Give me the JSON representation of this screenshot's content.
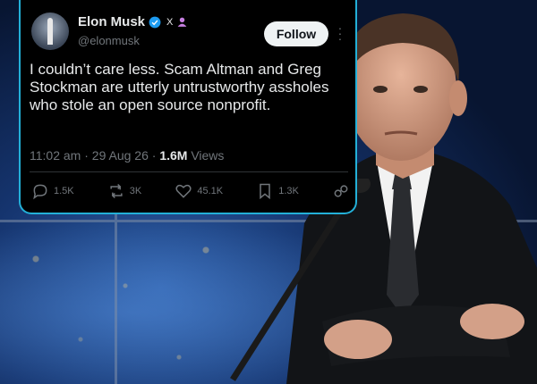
{
  "tweet": {
    "display_name": "Elon Musk",
    "x_badge": "X",
    "handle": "@elonmusk",
    "follow_label": "Follow",
    "text": "I couldn’t care less. Scam Altman and Greg Stockman are utterly untrustworthy assholes who stole an open source nonprofit.",
    "time": "11:02 am",
    "date": "29 Aug 26",
    "views_count": "1.6M",
    "views_label": "Views",
    "stats": {
      "replies": "1.5K",
      "reposts": "3K",
      "likes": "45.1K",
      "bookmarks": "1.3K"
    }
  },
  "icons": {
    "verified": "verified-check-icon",
    "affiliate": "person-badge-icon",
    "more": "more-options-icon",
    "reply": "reply-icon",
    "repost": "repost-icon",
    "like": "heart-icon",
    "bookmark": "bookmark-icon",
    "share": "share-icon"
  },
  "colors": {
    "tweet_bg": "#000000",
    "border": "#23b0d8",
    "verified": "#1d9bf0",
    "muted_text": "#71767b",
    "primary_text": "#e7e9ea",
    "follow_bg": "#eff3f4",
    "affiliate": "#c67fe0"
  }
}
